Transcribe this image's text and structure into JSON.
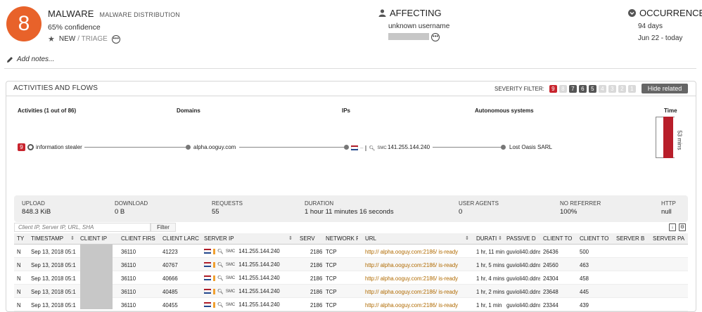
{
  "header": {
    "severity": "8",
    "title": "MALWARE",
    "subtitle": "MALWARE DISTRIBUTION",
    "confidence": "65% confidence",
    "status": "NEW",
    "stage": "/ TRIAGE",
    "affecting_label": "AFFECTING",
    "affecting_user": "unknown username",
    "occurrence_label": "OCCURRENCE",
    "occurrence_days": "94 days",
    "occurrence_range": "Jun 22 - today",
    "add_notes": "Add notes...",
    "colors": {
      "severity_bg": "#e8622a",
      "accent_red": "#c8242d"
    }
  },
  "panel": {
    "title": "ACTIVITIES AND FLOWS",
    "severity_filter_label": "SEVERITY FILTER:",
    "severity_chips": [
      {
        "n": "9",
        "color": "#c8242d"
      },
      {
        "n": "8",
        "color": "#d9d9d9"
      },
      {
        "n": "7",
        "color": "#555555"
      },
      {
        "n": "6",
        "color": "#555555"
      },
      {
        "n": "5",
        "color": "#555555"
      },
      {
        "n": "4",
        "color": "#d9d9d9"
      },
      {
        "n": "3",
        "color": "#d9d9d9"
      },
      {
        "n": "2",
        "color": "#d9d9d9"
      },
      {
        "n": "1",
        "color": "#d9d9d9"
      }
    ],
    "hide_related": "Hide related"
  },
  "flow": {
    "headers": {
      "activities": "Activities (1 out of 86)",
      "domains": "Domains",
      "ips": "IPs",
      "asn": "Autonomous systems",
      "time": "Time"
    },
    "activity_severity": "9",
    "activity": "information stealer",
    "domain": "alpha.ooguy.com",
    "ip": "141.255.144.240",
    "smc": "SMC",
    "asn": "Lost Oasis SARL",
    "time_label": "53 mins"
  },
  "stats": [
    {
      "label": "UPLOAD",
      "value": "848.3 KiB"
    },
    {
      "label": "DOWNLOAD",
      "value": "0 B"
    },
    {
      "label": "REQUESTS",
      "value": "55"
    },
    {
      "label": "DURATION",
      "value": "1 hour 11 minutes 16 seconds"
    },
    {
      "label": "USER AGENTS",
      "value": "0"
    },
    {
      "label": "NO REFERRER",
      "value": "100%"
    },
    {
      "label": "HTTP",
      "value": "null"
    }
  ],
  "search": {
    "placeholder": "Client IP, Server IP, URL, SHA",
    "filter_label": "Filter"
  },
  "table": {
    "columns": [
      "TY",
      "TIMESTAMP",
      "CLIENT IP",
      "CLIENT FIRS",
      "CLIENT LARC",
      "SERVER IP",
      "SERV",
      "NETWORK F",
      "URL",
      "DURATI",
      "PASSIVE D",
      "CLIENT TO",
      "CLIENT TO",
      "SERVER B",
      "SERVER PA"
    ],
    "rows": [
      {
        "type": "N",
        "ts": "Sep 13, 2018 05:1",
        "cfirst": "36110",
        "clast": "41223",
        "sip": "141.255.144.240",
        "port": "2186",
        "proto": "TCP",
        "url_scheme": "http://",
        "url_host": "alpha.ooguy.com:2186",
        "url_path": "/ is-ready",
        "dur": "1 hr, 11 min",
        "pdns": "guvioli40.ddns",
        "ct1": "26436",
        "ct2": "500"
      },
      {
        "type": "N",
        "ts": "Sep 13, 2018 05:1",
        "cfirst": "36110",
        "clast": "40767",
        "sip": "141.255.144.240",
        "port": "2186",
        "proto": "TCP",
        "url_scheme": "http://",
        "url_host": "alpha.ooguy.com:2186",
        "url_path": "/ is-ready",
        "dur": "1 hr, 5 mins",
        "pdns": "guvioli40.ddns",
        "ct1": "24560",
        "ct2": "463"
      },
      {
        "type": "N",
        "ts": "Sep 13, 2018 05:1",
        "cfirst": "36110",
        "clast": "40666",
        "sip": "141.255.144.240",
        "port": "2186",
        "proto": "TCP",
        "url_scheme": "http://",
        "url_host": "alpha.ooguy.com:2186",
        "url_path": "/ is-ready",
        "dur": "1 hr, 4 mins",
        "pdns": "guvioli40.ddns",
        "ct1": "24304",
        "ct2": "458"
      },
      {
        "type": "N",
        "ts": "Sep 13, 2018 05:1",
        "cfirst": "36110",
        "clast": "40485",
        "sip": "141.255.144.240",
        "port": "2186",
        "proto": "TCP",
        "url_scheme": "http://",
        "url_host": "alpha.ooguy.com:2186",
        "url_path": "/ is-ready",
        "dur": "1 hr, 2 mins",
        "pdns": "guvioli40.ddns",
        "ct1": "23648",
        "ct2": "445"
      },
      {
        "type": "N",
        "ts": "Sep 13, 2018 05:1",
        "cfirst": "36110",
        "clast": "40455",
        "sip": "141.255.144.240",
        "port": "2186",
        "proto": "TCP",
        "url_scheme": "http://",
        "url_host": "alpha.ooguy.com:2186",
        "url_path": "/ is-ready",
        "dur": "1 hr, 1 min",
        "pdns": "guvioli40.ddns",
        "ct1": "23344",
        "ct2": "439"
      }
    ]
  }
}
